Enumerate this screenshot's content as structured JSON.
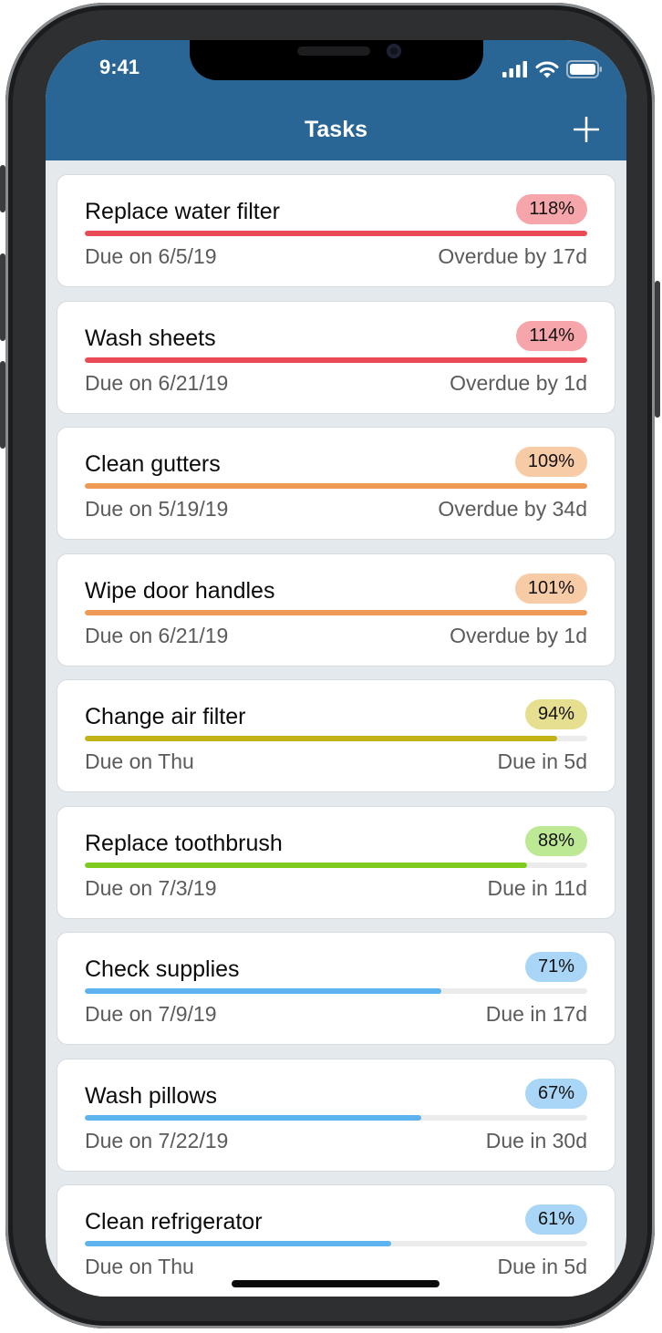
{
  "status_bar": {
    "time": "9:41"
  },
  "header": {
    "title": "Tasks"
  },
  "colors": {
    "header": "#2a6695",
    "red": "#ea4a55",
    "red_pill": "#f6a6ab",
    "orange": "#ee9a55",
    "orange_pill": "#f8cba7",
    "yellow": "#c2b216",
    "yellow_pill": "#e6df90",
    "green": "#7ecb1e",
    "green_pill": "#bde894",
    "blue": "#5cb3ee",
    "blue_pill": "#a9d6f6"
  },
  "tasks": [
    {
      "name": "Replace water filter",
      "percent": "118%",
      "progress": 1.0,
      "due": "Due on 6/5/19",
      "status": "Overdue by 17d",
      "level": "red"
    },
    {
      "name": "Wash sheets",
      "percent": "114%",
      "progress": 1.0,
      "due": "Due on 6/21/19",
      "status": "Overdue by 1d",
      "level": "red"
    },
    {
      "name": "Clean gutters",
      "percent": "109%",
      "progress": 1.0,
      "due": "Due on 5/19/19",
      "status": "Overdue by 34d",
      "level": "orange"
    },
    {
      "name": "Wipe door handles",
      "percent": "101%",
      "progress": 1.0,
      "due": "Due on 6/21/19",
      "status": "Overdue by 1d",
      "level": "orange"
    },
    {
      "name": "Change air filter",
      "percent": "94%",
      "progress": 0.94,
      "due": "Due on Thu",
      "status": "Due in 5d",
      "level": "yellow"
    },
    {
      "name": "Replace toothbrush",
      "percent": "88%",
      "progress": 0.88,
      "due": "Due on 7/3/19",
      "status": "Due in 11d",
      "level": "green"
    },
    {
      "name": "Check supplies",
      "percent": "71%",
      "progress": 0.71,
      "due": "Due on 7/9/19",
      "status": "Due in 17d",
      "level": "blue"
    },
    {
      "name": "Wash pillows",
      "percent": "67%",
      "progress": 0.67,
      "due": "Due on 7/22/19",
      "status": "Due in 30d",
      "level": "blue"
    },
    {
      "name": "Clean refrigerator",
      "percent": "61%",
      "progress": 0.61,
      "due": "Due on Thu",
      "status": "Due in 5d",
      "level": "blue"
    }
  ]
}
